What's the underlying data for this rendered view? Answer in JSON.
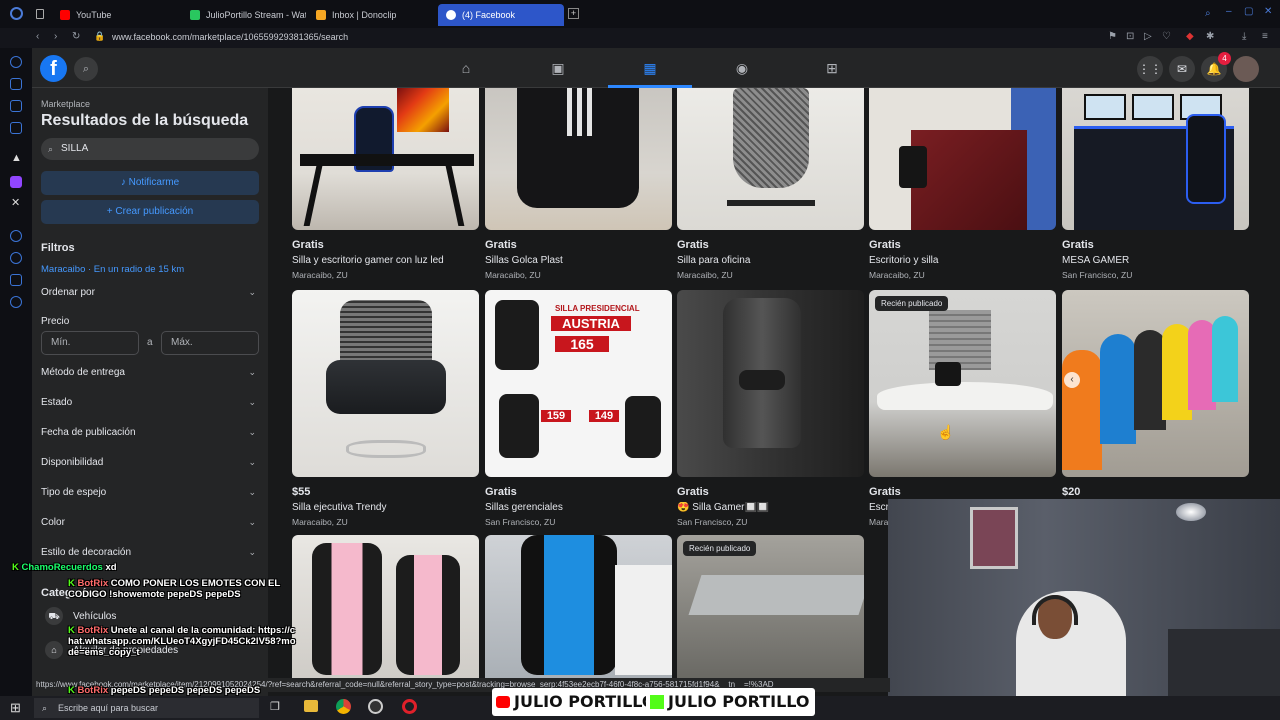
{
  "browser": {
    "tabs": [
      {
        "label": "YouTube",
        "color": "#ff0000"
      },
      {
        "label": "JulioPortillo Stream - Wat",
        "color": "#29c75f"
      },
      {
        "label": "Inbox | Donoclip",
        "color": "#f5a623"
      },
      {
        "label": "(4) Facebook",
        "color": "#1877f2"
      }
    ],
    "url": "www.facebook.com/marketplace/106559929381365/search"
  },
  "fb": {
    "logo": "f",
    "notif_count": "4"
  },
  "sidebar": {
    "crumb": "Marketplace",
    "title": "Resultados de la búsqueda",
    "search_value": "SILLA",
    "notify_label": "Notificarme",
    "create_label": "Crear publicación",
    "filters_heading": "Filtros",
    "location": "Maracaibo · En un radio de 15 km",
    "sort_label": "Ordenar por",
    "price_label": "Precio",
    "price_min_placeholder": "Mín.",
    "price_sep": "a",
    "price_max_placeholder": "Máx.",
    "delivery_label": "Método de entrega",
    "state_label": "Estado",
    "date_label": "Fecha de publicación",
    "availability_label": "Disponibilidad",
    "mirror_label": "Tipo de espejo",
    "color_label": "Color",
    "decor_label": "Estilo de decoración",
    "categories_heading": "Categorías",
    "cat_vehicles": "Vehículos",
    "cat_rent": "Alquiler de propiedades"
  },
  "listings": [
    {
      "price": "Gratis",
      "title": "Silla y escritorio gamer con luz led",
      "loc": "Maracaibo, ZU",
      "badge": ""
    },
    {
      "price": "Gratis",
      "title": "Sillas Golca Plast",
      "loc": "Maracaibo, ZU",
      "badge": ""
    },
    {
      "price": "Gratis",
      "title": "Silla para oficina",
      "loc": "Maracaibo, ZU",
      "badge": ""
    },
    {
      "price": "Gratis",
      "title": "Escritorio y silla",
      "loc": "Maracaibo, ZU",
      "badge": ""
    },
    {
      "price": "Gratis",
      "title": "MESA GAMER",
      "loc": "San Francisco, ZU",
      "badge": ""
    },
    {
      "price": "$55",
      "title": "Silla ejecutiva Trendy",
      "loc": "Maracaibo, ZU",
      "badge": ""
    },
    {
      "price": "Gratis",
      "title": "Sillas gerenciales",
      "loc": "San Francisco, ZU",
      "badge": ""
    },
    {
      "price": "Gratis",
      "title": "😍 Silla Gamer🔲🔲",
      "loc": "San Francisco, ZU",
      "badge": ""
    },
    {
      "price": "Gratis",
      "title": "Escri",
      "loc": "Mara",
      "badge": "Recién publicado"
    },
    {
      "price": "$20",
      "title": "",
      "loc": "",
      "badge": ""
    },
    {
      "price": "",
      "title": "",
      "loc": "",
      "badge": ""
    },
    {
      "price": "",
      "title": "",
      "loc": "",
      "badge": ""
    },
    {
      "price": "",
      "title": "",
      "loc": "",
      "badge": "Recién publicado"
    }
  ],
  "image_text": {
    "austria_title": "SILLA PRESIDENCIAL",
    "austria_name": "AUSTRIA",
    "austria_price": "165",
    "price2": "159",
    "price3": "149"
  },
  "chat": [
    {
      "user": "ChamoRecuerdos",
      "msg": "xd",
      "color": "#1aff6b"
    },
    {
      "user": "BotRix",
      "msg": "COMO PONER LOS EMOTES CON EL CODIGO !showemote pepeDS pepeDS",
      "color": "#ff6b6b"
    },
    {
      "user": "BotRix",
      "msg": "Unete al canal de la comunidad: https://chat.whatsapp.com/KLUeoT4XgyjFD45Ck2lV58?mode=ems_copy_t",
      "color": "#ff6b6b"
    },
    {
      "user": "BotRix",
      "msg": "pepeDS pepeDS pepeDS pepeDS",
      "color": "#ff6b6b"
    }
  ],
  "status_url": "https://www.facebook.com/marketplace/item/2120991052024254/?ref=search&referral_code=null&referral_story_type=post&tracking=browse_serp:4f53ee2ecb7f-46f0-4f8c-a756-581715fd1f94&__tn__=!%3AD",
  "taskbar": {
    "search_placeholder": "Escribe aquí para buscar"
  },
  "stream": {
    "name_youtube": "JULIO PORTILLO",
    "name_kick": "JULIO PORTILLO"
  }
}
